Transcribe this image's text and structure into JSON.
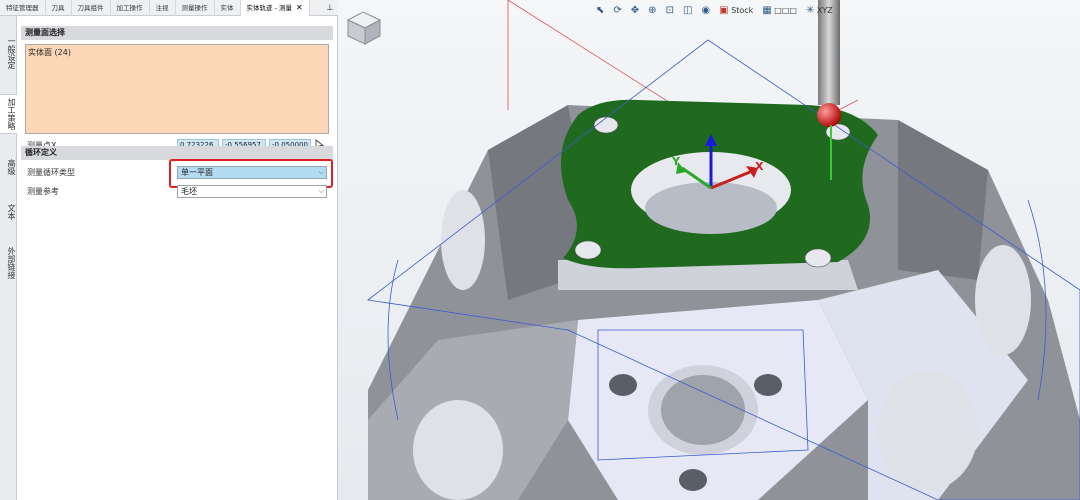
{
  "tabs": [
    "特征管理器",
    "刀具",
    "刀具组件",
    "加工操作",
    "注视",
    "测量操作",
    "实体",
    "实体轨迹 - 测量"
  ],
  "active_tab": "实体轨迹 - 测量",
  "close_glyph": "✕",
  "pin_glyph": "⊥",
  "vtabs": [
    "一般设定",
    "加工策略",
    "高级",
    "文本",
    "外部链接"
  ],
  "section1": {
    "title": "测量面选择",
    "face_item": "实体面 (24)",
    "point_label": "测量点X",
    "coords": [
      "0.723226",
      "-0.556957",
      "-0.050000"
    ]
  },
  "section2": {
    "title": "循环定义",
    "cycle_type_label": "测量循环类型",
    "cycle_type_value": "单一平面",
    "reference_label": "测量参考",
    "reference_value": "毛坯"
  },
  "viewport_toolbar": {
    "stock_label": "Stock",
    "dot_label": "□□□",
    "axis_label": "XYZ"
  },
  "axes": {
    "x": "X",
    "y": "Y"
  },
  "colors": {
    "highlight_red": "#e02020",
    "face_green": "#1f6a1f",
    "selection_orange": "#fcd8b8",
    "combo_blue": "#b3dbf2"
  }
}
